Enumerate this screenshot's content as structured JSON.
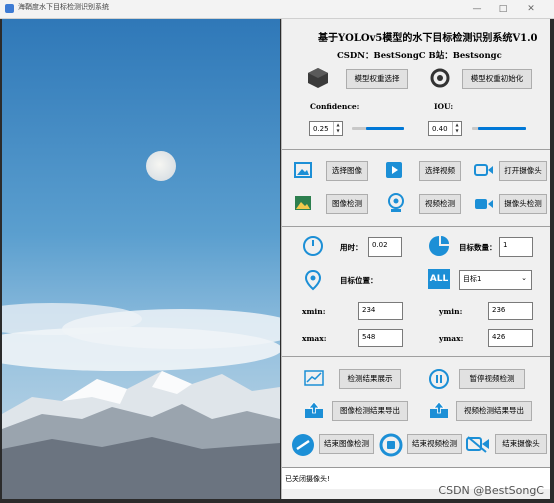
{
  "window": {
    "title": "海鞘度水下目标检测识别系统",
    "minimize": "—",
    "maximize": "□",
    "close": "✕"
  },
  "header": {
    "title": "基于YOLOv5模型的水下目标检测识别系统V1.0",
    "csdn": "CSDN：BestSongC  B站：Bestsongc"
  },
  "model": {
    "select_label": "模型权重选择",
    "init_label": "模型权重初始化"
  },
  "confidence": {
    "label": "Confidence:",
    "value": "0.25",
    "level": 0.25
  },
  "iou": {
    "label": "IOU:",
    "value": "0.40",
    "level": 0.4
  },
  "actions": {
    "select_image": "选择图像",
    "select_video": "选择视频",
    "open_camera": "打开摄像头",
    "image_detect": "图像检测",
    "video_detect": "视频检测",
    "camera_detect": "摄像头检测"
  },
  "stats": {
    "time_label": "用时：",
    "time_value": "0.02",
    "count_label": "目标数量：",
    "count_value": "1",
    "position_label": "目标位置：",
    "target_select": "目标1",
    "xmin_label": "xmin:",
    "xmin_value": "234",
    "ymin_label": "ymin:",
    "ymin_value": "236",
    "xmax_label": "xmax:",
    "xmax_value": "548",
    "ymax_label": "ymax:",
    "ymax_value": "426"
  },
  "results": {
    "show_results": "检测结果展示",
    "pause_video": "暂停视频检测",
    "export_image": "图像检测结果导出",
    "export_video": "视频检测结果导出",
    "end_image": "结束图像检测",
    "end_video": "结束视频检测",
    "end_camera": "结束摄像头"
  },
  "status": {
    "text": "已关闭摄像头!"
  },
  "watermark": "CSDN @BestSongC",
  "colors": {
    "accent": "#1c8fd6",
    "icon_blue": "#2f8fdc"
  }
}
